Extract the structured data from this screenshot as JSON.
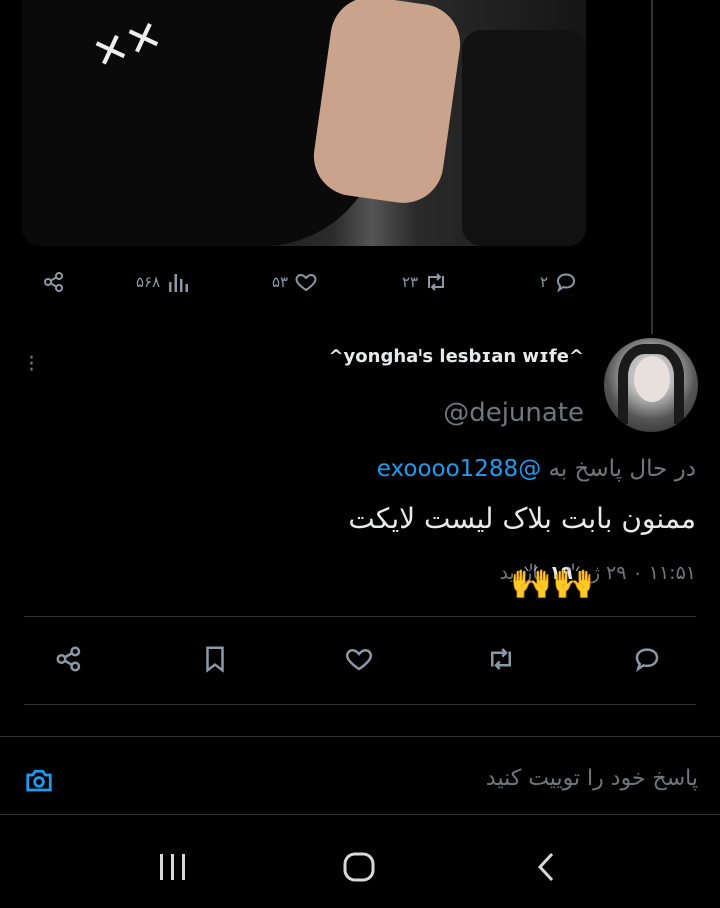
{
  "top_tweet": {
    "stats": {
      "replies": "۲",
      "retweets": "۲۳",
      "likes": "۵۳",
      "views": "۵۶۸"
    }
  },
  "reply": {
    "display_name": "^yonghaᑊs lesbɪan wɪfe^",
    "handle": "@dejunate",
    "replying_prefix": "در حال پاسخ به",
    "replying_to": "@exoooo1288",
    "text": "ممنون بابت بلاک لیست لایکت",
    "time_date": "۱۱:۵۱ ۰ ۲۹ ژ",
    "views_count": "۱۹",
    "views_label": "بازدید",
    "emoji": "🙌🙌"
  },
  "compose": {
    "placeholder": "پاسخ خود را توییت کنید"
  },
  "colors": {
    "accent": "#1d9bf0",
    "muted": "#71767b",
    "background": "#000000"
  }
}
